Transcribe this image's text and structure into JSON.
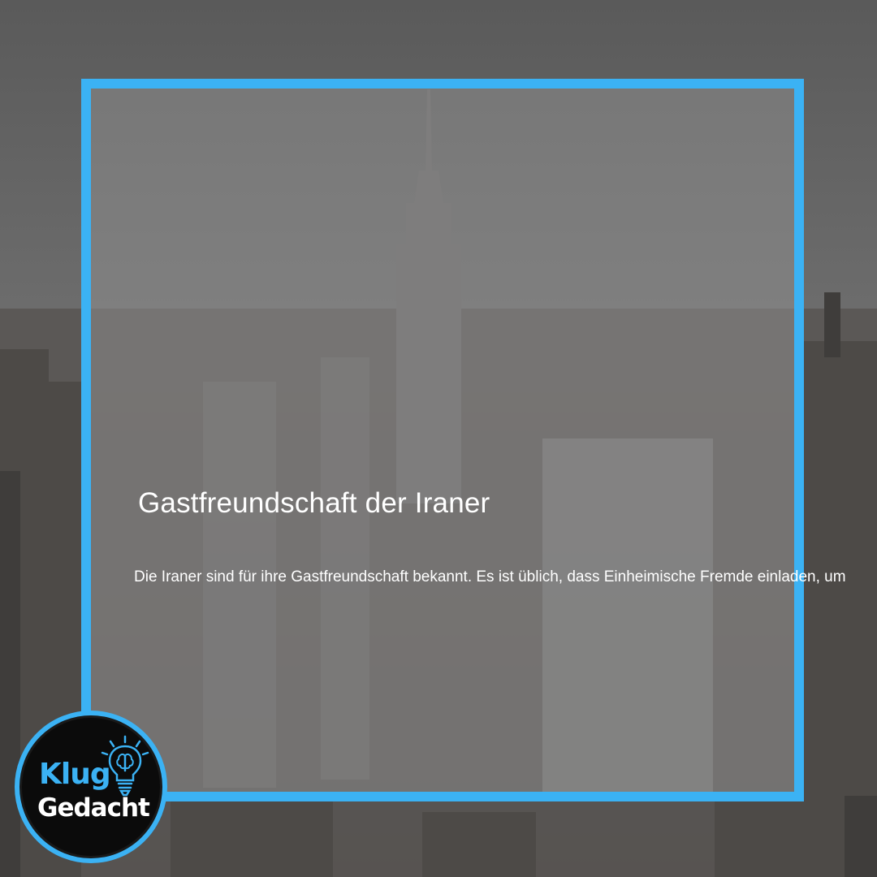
{
  "card": {
    "title": "Gastfreundschaft der Iraner",
    "body": "Die Iraner sind für ihre Gastfreundschaft bekannt. Es ist üblich, dass Einheimische Fremde einladen, um"
  },
  "logo": {
    "line1": "Klug",
    "line2": "Gedacht",
    "icon": "lightbulb-brain-icon"
  },
  "colors": {
    "accent": "#3bb2f4",
    "text": "#ffffff",
    "logo_bg": "#0b0b0b"
  }
}
